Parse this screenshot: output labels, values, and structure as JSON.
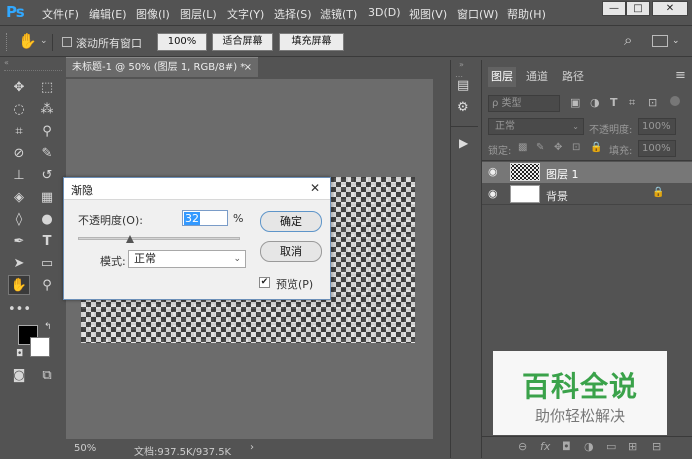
{
  "app": {
    "logo": "Ps"
  },
  "menu": [
    "文件(F)",
    "编辑(E)",
    "图像(I)",
    "图层(L)",
    "文字(Y)",
    "选择(S)",
    "滤镜(T)",
    "3D(D)",
    "视图(V)",
    "窗口(W)",
    "帮助(H)"
  ],
  "window_controls": {
    "minimize": "—",
    "restore": "□",
    "close": "✕"
  },
  "options_bar": {
    "scroll_all_label": "滚动所有窗口",
    "zoom_100": "100%",
    "fit_screen": "适合屏幕",
    "fill_screen": "填充屏幕"
  },
  "document": {
    "tab_title": "未标题-1 @ 50% (图层 1, RGB/8#) *",
    "close": "×"
  },
  "status": {
    "zoom": "50%",
    "doc_size": "文档:937.5K/937.5K",
    "arrow": "›"
  },
  "layers_panel": {
    "tabs": [
      "图层",
      "通道",
      "路径"
    ],
    "filter_label": "ρ 类型",
    "blend_mode": "正常",
    "opacity_label": "不透明度:",
    "opacity_value": "100%",
    "lock_label": "锁定:",
    "fill_label": "填充:",
    "fill_value": "100%",
    "layers": [
      {
        "name": "图层 1",
        "selected": true
      },
      {
        "name": "背景",
        "selected": false
      }
    ]
  },
  "dialog": {
    "title": "渐隐",
    "opacity_label": "不透明度(O):",
    "opacity_value": "32",
    "opacity_unit": "%",
    "opacity_slider_level": 0.32,
    "mode_label": "模式:",
    "mode_value": "正常",
    "ok": "确定",
    "cancel": "取消",
    "preview": "预览(P)",
    "preview_checked": true,
    "close": "✕"
  },
  "watermark": {
    "title": "百科全说",
    "subtitle": "助你轻松解决"
  },
  "colors": {
    "accent": "#31a8ff",
    "watermark_green": "#3aa24a",
    "dialog_border": "#6b8fb8"
  }
}
